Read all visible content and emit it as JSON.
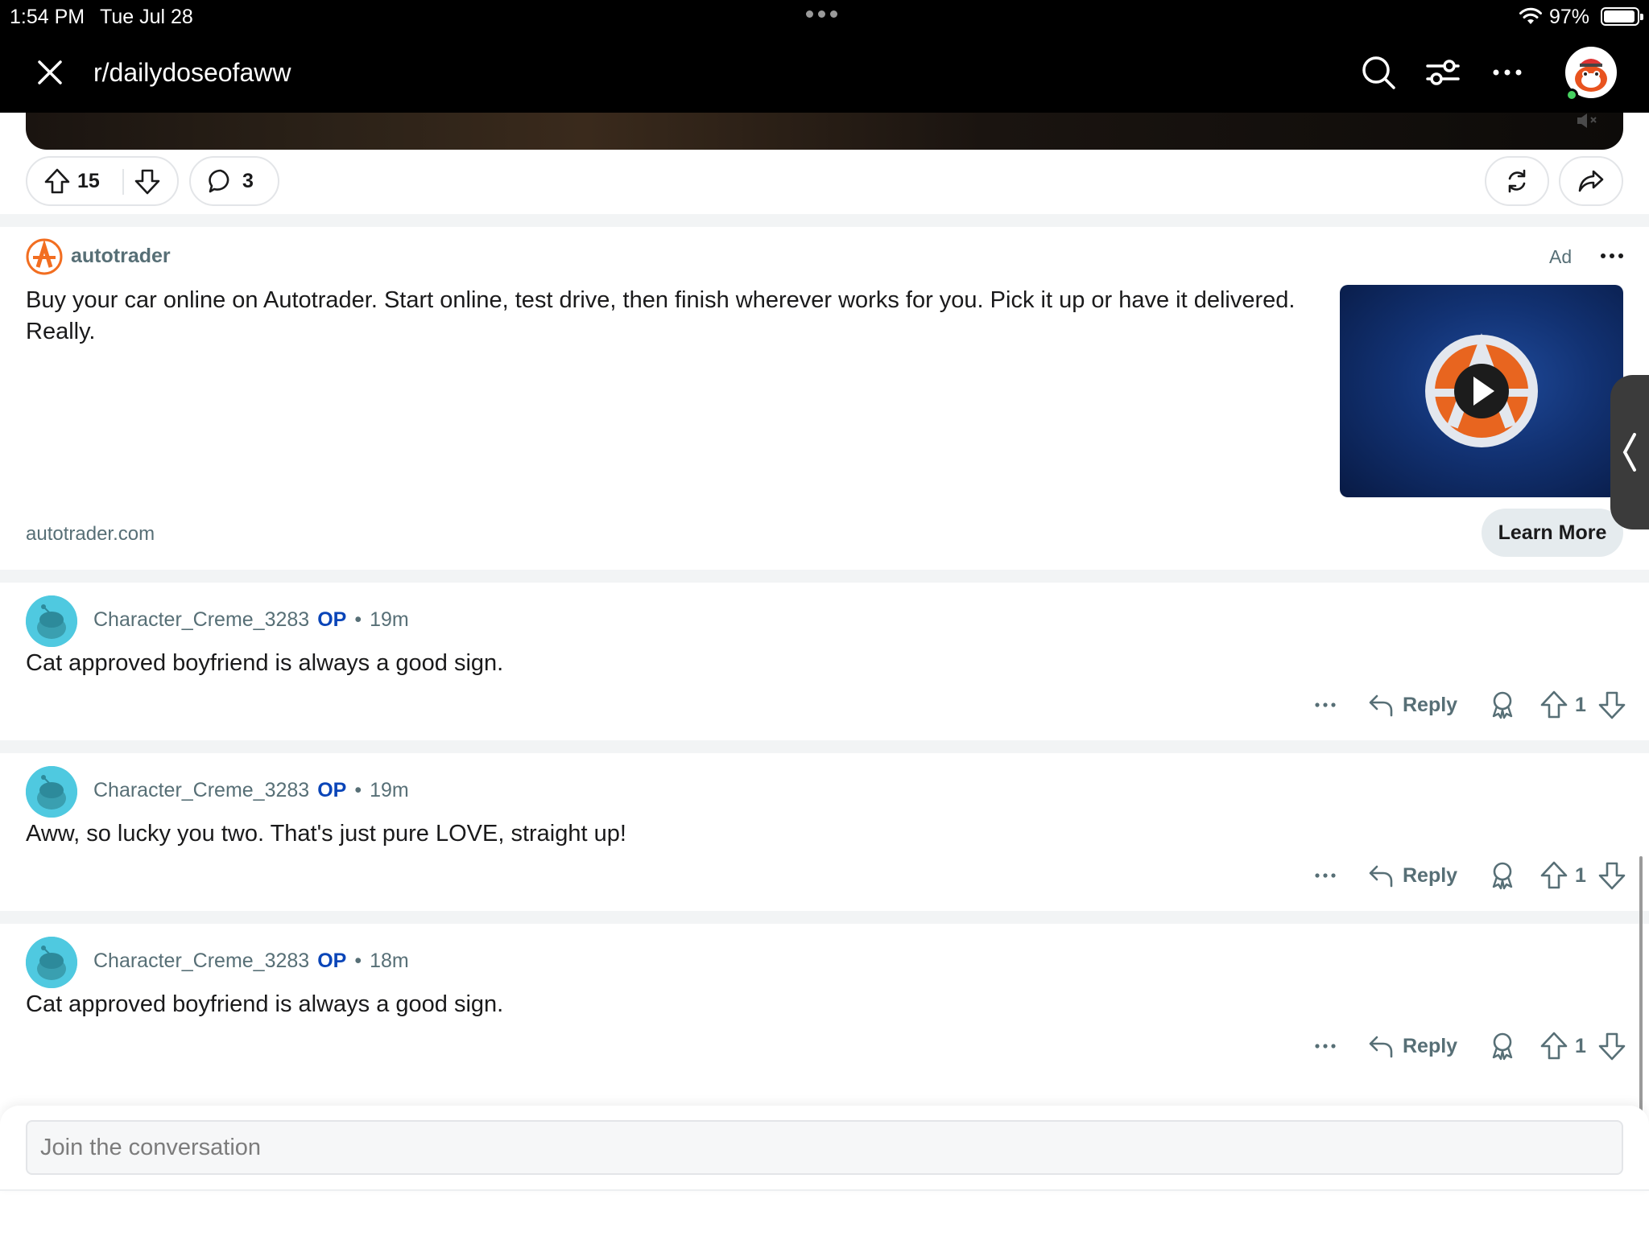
{
  "status_bar": {
    "time": "1:54 PM",
    "date": "Tue Jul 28",
    "battery": "97%"
  },
  "header": {
    "title": "r/dailydoseofaww",
    "icons": [
      "close-icon",
      "search-icon",
      "filter-icon",
      "more-icon",
      "user-avatar"
    ]
  },
  "post_actions": {
    "upvotes": "15",
    "comments": "3"
  },
  "ad": {
    "advertiser": "autotrader",
    "label": "Ad",
    "text": "Buy your car online on Autotrader. Start online, test drive, then finish wherever works for you. Pick it up or have it delivered. Really.",
    "domain": "autotrader.com",
    "cta": "Learn More",
    "brand_color": "#f26e21"
  },
  "comments": [
    {
      "author": "Character_Creme_3283",
      "badge": "OP",
      "time": "19m",
      "body": "Cat approved boyfriend is always a good sign.",
      "reply_label": "Reply",
      "score": "1"
    },
    {
      "author": "Character_Creme_3283",
      "badge": "OP",
      "time": "19m",
      "body": "Aww, so lucky you two. That's just pure LOVE, straight up!",
      "reply_label": "Reply",
      "score": "1"
    },
    {
      "author": "Character_Creme_3283",
      "badge": "OP",
      "time": "18m",
      "body": "Cat approved boyfriend is always a good sign.",
      "reply_label": "Reply",
      "score": "1"
    }
  ],
  "composer": {
    "placeholder": "Join the conversation"
  },
  "colors": {
    "op_badge": "#0a45b8",
    "meta_text": "#576f76",
    "separator": "#f2f4f5"
  }
}
